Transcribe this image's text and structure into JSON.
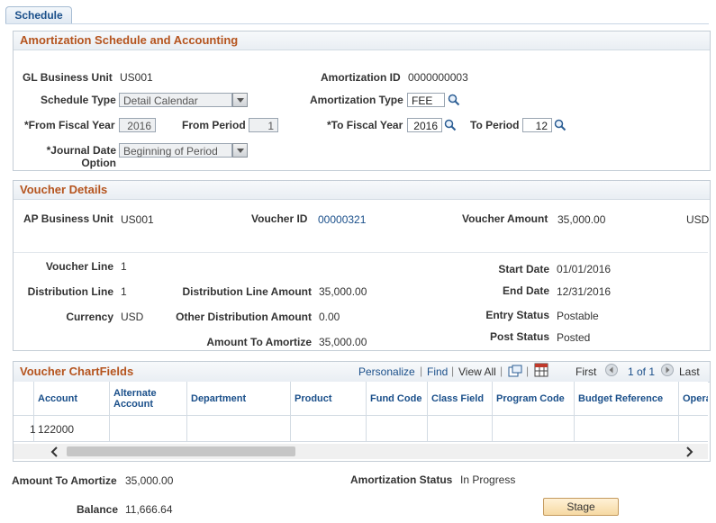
{
  "tab": {
    "label": "Schedule"
  },
  "amort": {
    "title": "Amortization Schedule and Accounting",
    "gl_bu_label": "GL Business Unit",
    "gl_bu": "US001",
    "amort_id_label": "Amortization ID",
    "amort_id": "0000000003",
    "sched_type_label": "Schedule Type",
    "sched_type": "Detail Calendar",
    "amort_type_label": "Amortization Type",
    "amort_type": "FEE",
    "from_fy_label": "*From Fiscal Year",
    "from_fy": "2016",
    "from_period_label": "From Period",
    "from_period": "1",
    "to_fy_label": "*To Fiscal Year",
    "to_fy": "2016",
    "to_period_label": "To Period",
    "to_period": "12",
    "jdo_label1": "*Journal Date",
    "jdo_label2": "Option",
    "jdo": "Beginning of Period"
  },
  "voucher": {
    "title": "Voucher Details",
    "ap_bu_label": "AP Business Unit",
    "ap_bu": "US001",
    "vid_label": "Voucher ID",
    "vid": "00000321",
    "vamt_label": "Voucher Amount",
    "vamt": "35,000.00",
    "currency_code": "USD",
    "vline_label": "Voucher Line",
    "vline": "1",
    "dline_label": "Distribution Line",
    "dline": "1",
    "currency_label": "Currency",
    "currency": "USD",
    "dla_label": "Distribution Line Amount",
    "dla": "35,000.00",
    "oda_label": "Other Distribution Amount",
    "oda": "0.00",
    "ata_label": "Amount To Amortize",
    "ata": "35,000.00",
    "start_label": "Start Date",
    "start": "01/01/2016",
    "end_label": "End Date",
    "end": "12/31/2016",
    "entry_label": "Entry Status",
    "entry": "Postable",
    "post_label": "Post Status",
    "post": "Posted"
  },
  "chartfields": {
    "title": "Voucher ChartFields",
    "personalize": "Personalize",
    "find": "Find",
    "viewall": "View All",
    "first": "First",
    "range": "1 of 1",
    "last": "Last",
    "columns": [
      "Account",
      "Alternate Account",
      "Department",
      "Product",
      "Fund Code",
      "Class Field",
      "Program Code",
      "Budget Reference",
      "Opera"
    ],
    "row_num": "1",
    "row_account": "122000"
  },
  "footer": {
    "ata_label": "Amount To Amortize",
    "ata": "35,000.00",
    "status_label": "Amortization Status",
    "status": "In Progress",
    "balance_label": "Balance",
    "balance": "11,666.64",
    "stage_label": "Stage"
  },
  "colors": {
    "accent": "#b5541e",
    "link": "#1a4f8a"
  }
}
